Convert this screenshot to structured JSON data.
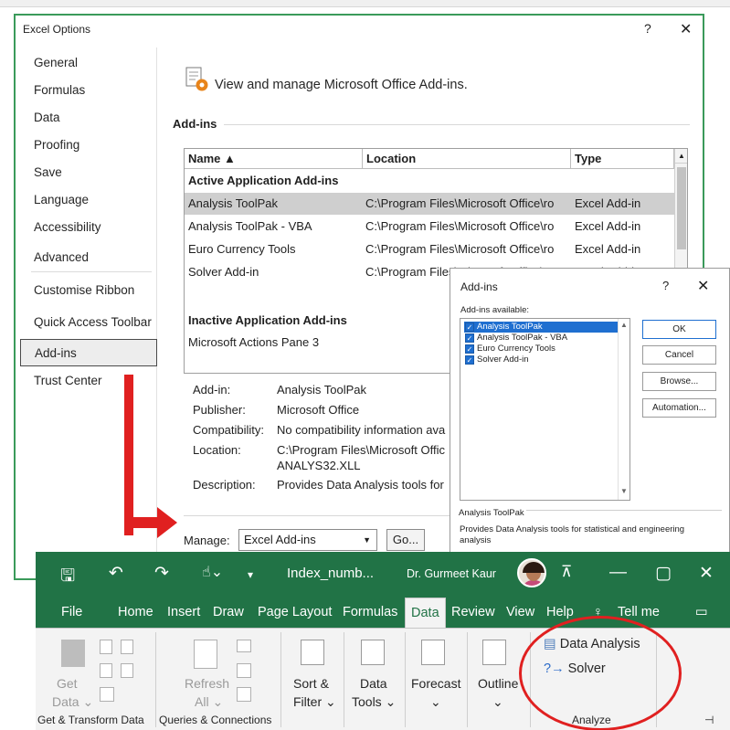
{
  "options_dialog": {
    "title": "Excel Options",
    "help": "?",
    "close": "✕",
    "nav": [
      {
        "label": "General"
      },
      {
        "label": "Formulas"
      },
      {
        "label": "Data"
      },
      {
        "label": "Proofing"
      },
      {
        "label": "Save"
      },
      {
        "label": "Language"
      },
      {
        "label": "Accessibility"
      },
      {
        "label": "Advanced"
      },
      {
        "label": "Customise Ribbon"
      },
      {
        "label": "Quick Access Toolbar"
      },
      {
        "label": "Add-ins"
      },
      {
        "label": "Trust Center"
      }
    ],
    "selected_nav": "Add-ins",
    "header": "View and manage Microsoft Office Add-ins.",
    "section": "Add-ins",
    "table": {
      "columns": [
        "Name ▲",
        "Location",
        "Type"
      ],
      "active_group": "Active Application Add-ins",
      "active_rows": [
        {
          "name": "Analysis ToolPak",
          "location": "C:\\Program Files\\Microsoft Office\\ro",
          "type": "Excel Add-in"
        },
        {
          "name": "Analysis ToolPak - VBA",
          "location": "C:\\Program Files\\Microsoft Office\\ro",
          "type": "Excel Add-in"
        },
        {
          "name": "Euro Currency Tools",
          "location": "C:\\Program Files\\Microsoft Office\\ro",
          "type": "Excel Add-in"
        },
        {
          "name": "Solver Add-in",
          "location": "C:\\Program Files\\Microsoft Office\\ro",
          "type": "Excel Add-in"
        }
      ],
      "inactive_group": "Inactive Application Add-ins",
      "inactive_rows": [
        {
          "name": "Microsoft Actions Pane 3"
        }
      ]
    },
    "info": {
      "addin_label": "Add-in:",
      "addin_value": "Analysis ToolPak",
      "publisher_label": "Publisher:",
      "publisher_value": "Microsoft Office",
      "compat_label": "Compatibility:",
      "compat_value": "No compatibility information ava",
      "location_label": "Location:",
      "location_value1": "C:\\Program Files\\Microsoft Offic",
      "location_value2": "ANALYS32.XLL",
      "desc_label": "Description:",
      "desc_value": "Provides Data Analysis tools for"
    },
    "manage_label": "Manage:",
    "manage_value": "Excel Add-ins",
    "go_label": "Go..."
  },
  "addins_dialog": {
    "title": "Add-ins",
    "help": "?",
    "close": "✕",
    "available_label": "Add-ins available:",
    "items": [
      {
        "label": "Analysis ToolPak",
        "checked": true
      },
      {
        "label": "Analysis ToolPak - VBA",
        "checked": true
      },
      {
        "label": "Euro Currency Tools",
        "checked": true
      },
      {
        "label": "Solver Add-in",
        "checked": true
      }
    ],
    "buttons": {
      "ok": "OK",
      "cancel": "Cancel",
      "browse": "Browse...",
      "automation": "Automation..."
    },
    "group_label": "Analysis ToolPak",
    "description": "Provides Data Analysis tools for statistical and engineering analysis"
  },
  "excel_ribbon": {
    "file_name": "Index_numb...",
    "user": "Dr. Gurmeet Kaur",
    "tabs": [
      "File",
      "Home",
      "Insert",
      "Draw",
      "Page Layout",
      "Formulas",
      "Data",
      "Review",
      "View",
      "Help",
      "Tell me"
    ],
    "active_tab": "Data",
    "buttons": {
      "get_data": "Get",
      "get_data2": "Data ⌄",
      "refresh": "Refresh",
      "refresh2": "All ⌄",
      "sort_filter": "Sort &",
      "sort_filter2": "Filter ⌄",
      "data_tools": "Data",
      "data_tools2": "Tools ⌄",
      "forecast": "Forecast",
      "forecast2": "⌄",
      "outline": "Outline",
      "outline2": "⌄",
      "data_analysis": "Data Analysis",
      "solver": "Solver"
    },
    "groups": {
      "get_transform": "Get & Transform Data",
      "queries": "Queries & Connections",
      "analyze": "Analyze"
    }
  },
  "colors": {
    "excel_green": "#217346",
    "annotation_red": "#e02020",
    "accent_blue": "#1f6fd0"
  }
}
